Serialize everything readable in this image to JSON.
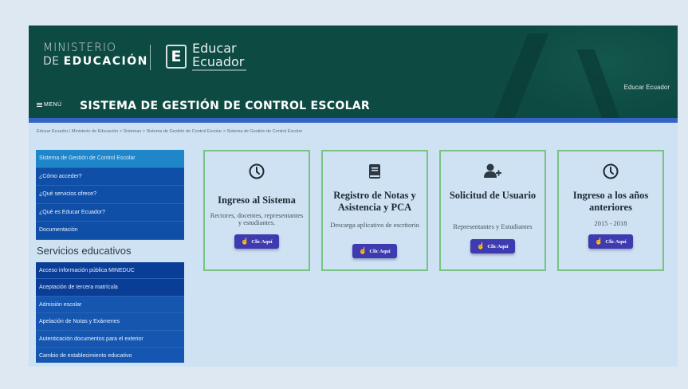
{
  "header": {
    "ministerio_line1": "MINISTERIO",
    "ministerio_line2_prefix": "DE ",
    "ministerio_line2_bold": "EDUCACIÓN",
    "logo_letter": "E",
    "educar_line1": "Educar",
    "educar_line2": "Ecuador",
    "top_link": "Educar Ecuador",
    "menu_label": "MENÚ",
    "system_title": "SISTEMA DE GESTIÓN DE CONTROL ESCOLAR"
  },
  "breadcrumb": "Educar Ecuador | Ministerio de Educación > Sistemas > Sistema de Gestión de Control Escolar > Sistema de Gestión de Control Escolar",
  "sidebar": {
    "items": [
      {
        "label": "Sistema de Gestión de Control Escolar"
      },
      {
        "label": "¿Cómo acceder?"
      },
      {
        "label": "¿Qué servicios ofrece?"
      },
      {
        "label": "¿Qué es Educar Ecuador?"
      },
      {
        "label": "Documentación"
      }
    ],
    "heading": "Servicios educativos",
    "services": [
      {
        "label": "Acceso información pública MINEDUC"
      },
      {
        "label": "Aceptación de tercera matrícula"
      },
      {
        "label": "Admisión escolar"
      },
      {
        "label": "Apelación de Notas y Exámenes"
      },
      {
        "label": "Autenticación documentos para el exterior"
      },
      {
        "label": "Cambio de establecimiento educativo"
      }
    ]
  },
  "cards": [
    {
      "icon": "clock-icon",
      "title": "Ingreso al Sistema",
      "desc": "Rectores, docentes, representantes y estudiantes.",
      "button": "Clic Aquí"
    },
    {
      "icon": "book-icon",
      "title": "Registro de Notas y Asistencia y PCA",
      "desc": "Descarga aplicativo de escritorio",
      "button": "Clic Aquí"
    },
    {
      "icon": "user-add-icon",
      "title": "Solicitud de Usuario",
      "desc": "Representantes y Estudiantes",
      "button": "Clic Aquí"
    },
    {
      "icon": "clock-icon",
      "title": "Ingreso a los años anteriores",
      "desc": "2015 - 2018",
      "button": "Clic Aquí"
    }
  ],
  "colors": {
    "header_bg": "#0d4a42",
    "accent_bar": "#3465c6",
    "sidebar_bg": "#0f4fa8",
    "card_border": "#77c383",
    "button_bg": "#3e3ab0"
  }
}
